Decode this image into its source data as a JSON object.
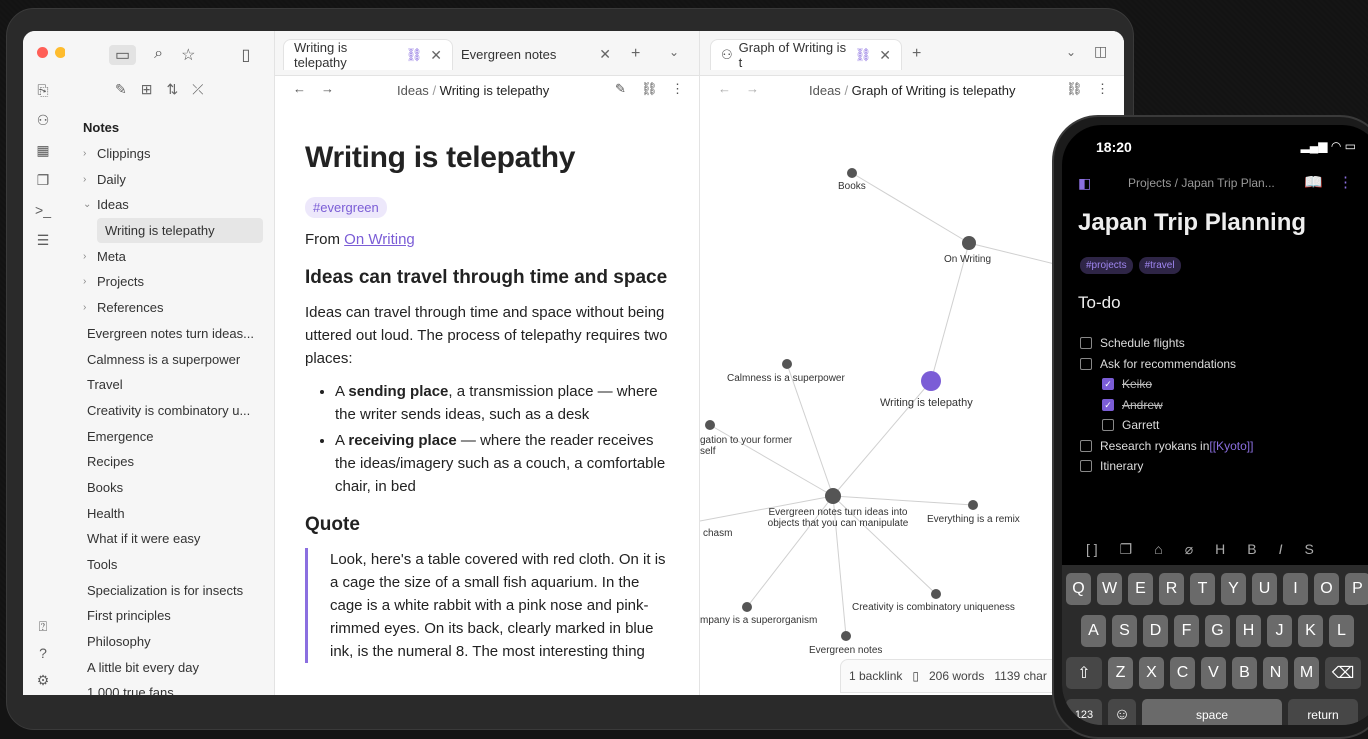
{
  "colors": {
    "accent": "#7b5dd6",
    "red": "#ff5f57",
    "yellow": "#febc2e",
    "green": "#28c840"
  },
  "sidebar": {
    "items": [
      {
        "label": "Notes",
        "type": "head"
      },
      {
        "label": "Clippings",
        "type": "folder"
      },
      {
        "label": "Daily",
        "type": "folder"
      },
      {
        "label": "Ideas",
        "type": "folder-open"
      },
      {
        "label": "Writing is telepathy",
        "type": "selected"
      },
      {
        "label": "Meta",
        "type": "folder"
      },
      {
        "label": "Projects",
        "type": "folder"
      },
      {
        "label": "References",
        "type": "folder"
      },
      {
        "label": "Evergreen notes turn ideas...",
        "type": "file"
      },
      {
        "label": "Calmness is a superpower",
        "type": "file"
      },
      {
        "label": "Travel",
        "type": "file"
      },
      {
        "label": "Creativity is combinatory u...",
        "type": "file"
      },
      {
        "label": "Emergence",
        "type": "file"
      },
      {
        "label": "Recipes",
        "type": "file"
      },
      {
        "label": "Books",
        "type": "file"
      },
      {
        "label": "Health",
        "type": "file"
      },
      {
        "label": "What if it were easy",
        "type": "file"
      },
      {
        "label": "Tools",
        "type": "file"
      },
      {
        "label": "Specialization is for insects",
        "type": "file"
      },
      {
        "label": "First principles",
        "type": "file"
      },
      {
        "label": "Philosophy",
        "type": "file"
      },
      {
        "label": "A little bit every day",
        "type": "file"
      },
      {
        "label": "1,000 true fans",
        "type": "file"
      }
    ]
  },
  "editor": {
    "tab1": "Writing is telepathy",
    "tab2": "Evergreen notes",
    "crumb_folder": "Ideas",
    "crumb_note": "Writing is telepathy",
    "title": "Writing is telepathy",
    "tag": "#evergreen",
    "from_prefix": "From ",
    "from_link": "On Writing",
    "h2a": "Ideas can travel through time and space",
    "para": "Ideas can travel through time and space without being uttered out loud. The process of telepathy requires two places:",
    "li1_a": "A ",
    "li1_b": "sending place",
    "li1_c": ", a transmission place — where the writer sends ideas, such as a desk",
    "li2_a": "A ",
    "li2_b": "receiving place",
    "li2_c": " — where the reader receives the ideas/imagery such as a couch, a comfortable chair, in bed",
    "h2b": "Quote",
    "quote": "Look, here's a table covered with red cloth. On it is a cage the size of a small fish aquarium. In the cage is a white rabbit with a pink nose and pink-rimmed eyes. On its back, clearly marked in blue ink, is the numeral 8. The most interesting thing"
  },
  "graph": {
    "tab": "Graph of Writing is t",
    "crumb_folder": "Ideas",
    "crumb_note": "Graph of Writing is telepathy",
    "nodes": [
      {
        "label": "Books"
      },
      {
        "label": "On Writing"
      },
      {
        "label": "Calmness is a superpower"
      },
      {
        "label": "Writing is telepathy"
      },
      {
        "label": "gation to your former self"
      },
      {
        "label": "Evergreen notes turn ideas into objects that you can manipulate"
      },
      {
        "label": "Everything is a remix"
      },
      {
        "label": "chasm"
      },
      {
        "label": "Creativity is combinatory uniqueness"
      },
      {
        "label": "mpany is a superorganism"
      },
      {
        "label": "Evergreen notes"
      }
    ],
    "status": {
      "backlinks": "1 backlink",
      "words": "206 words",
      "chars": "1139 char"
    }
  },
  "phone": {
    "time": "18:20",
    "breadcrumb": "Projects / Japan Trip Plan...",
    "title": "Japan Trip Planning",
    "tags": [
      "#projects",
      "#travel"
    ],
    "section": "To-do",
    "todos": [
      {
        "label": "Schedule flights",
        "done": false,
        "indent": false
      },
      {
        "label": "Ask for recommendations",
        "done": false,
        "indent": false
      },
      {
        "label": "Keiko",
        "done": true,
        "indent": true
      },
      {
        "label": "Andrew",
        "done": true,
        "indent": true
      },
      {
        "label": "Garrett",
        "done": false,
        "indent": true
      },
      {
        "label": "Research ryokans in ",
        "link": "[[Kyoto]]",
        "done": false,
        "indent": false
      },
      {
        "label": "Itinerary",
        "done": false,
        "indent": false
      }
    ],
    "kb_row1": [
      "Q",
      "W",
      "E",
      "R",
      "T",
      "Y",
      "U",
      "I",
      "O",
      "P"
    ],
    "kb_row2": [
      "A",
      "S",
      "D",
      "F",
      "G",
      "H",
      "J",
      "K",
      "L"
    ],
    "kb_row3": [
      "Z",
      "X",
      "C",
      "V",
      "B",
      "N",
      "M"
    ],
    "kb_space": "space",
    "kb_return": "return",
    "kb_num": "123"
  }
}
